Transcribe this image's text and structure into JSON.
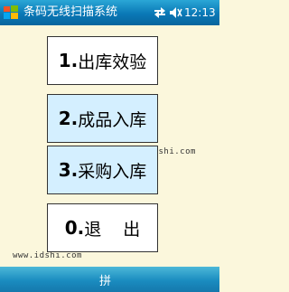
{
  "titlebar": {
    "title": "条码无线扫描系统",
    "time": "12:13",
    "icons": [
      "windows-start-icon",
      "connectivity-icon",
      "volume-icon"
    ]
  },
  "menu": {
    "items": [
      {
        "number": "1.",
        "label": "出库效验"
      },
      {
        "number": "2.",
        "label": "成品入库"
      },
      {
        "number": "3.",
        "label": "采购入库"
      },
      {
        "number": "0.",
        "label_a": "退",
        "label_b": "出"
      }
    ]
  },
  "watermarks": [
    "www.idshi.com",
    "www.idshi.com"
  ],
  "bottombar": {
    "softkey": "拼"
  },
  "colors": {
    "background": "#fbf7dc",
    "titlebar": "#0a78b6",
    "button_highlight": "#d4efff"
  }
}
